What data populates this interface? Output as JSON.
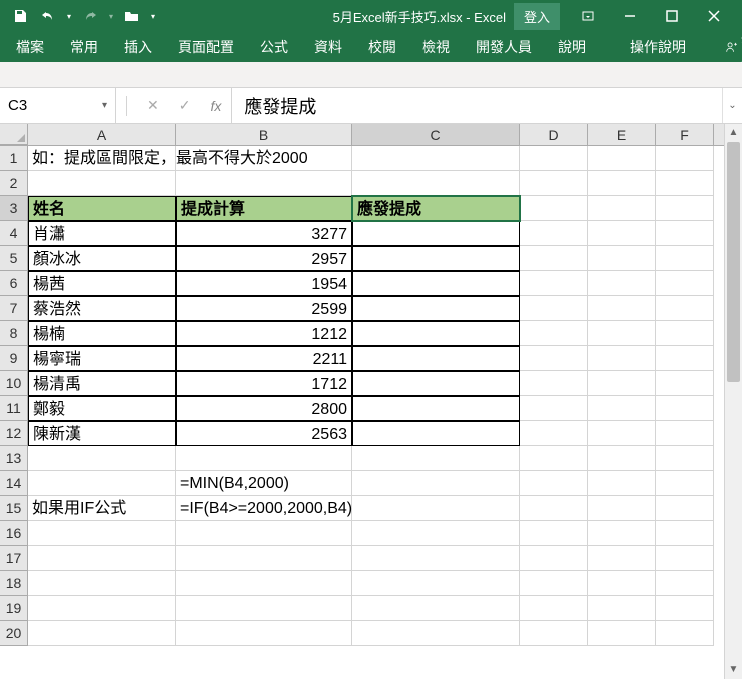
{
  "titlebar": {
    "filename": "5月Excel新手技巧.xlsx - Excel",
    "login": "登入"
  },
  "ribbon": {
    "tabs": [
      "檔案",
      "常用",
      "插入",
      "頁面配置",
      "公式",
      "資料",
      "校閱",
      "檢視",
      "開發人員",
      "說明"
    ],
    "tell_me": "操作說明",
    "share": "共用"
  },
  "formula_bar": {
    "name_box": "C3",
    "fx": "fx",
    "value": "應發提成"
  },
  "columns": [
    "A",
    "B",
    "C",
    "D",
    "E",
    "F"
  ],
  "sheet": {
    "row1": {
      "A": "如：提成區間限定，最高不得大於2000"
    },
    "headers": {
      "A": "姓名",
      "B": "提成計算",
      "C": "應發提成"
    },
    "data_rows": [
      {
        "r": 4,
        "name": "肖瀟",
        "calc": 3277
      },
      {
        "r": 5,
        "name": "顏冰冰",
        "calc": 2957
      },
      {
        "r": 6,
        "name": "楊茜",
        "calc": 1954
      },
      {
        "r": 7,
        "name": "蔡浩然",
        "calc": 2599
      },
      {
        "r": 8,
        "name": "楊楠",
        "calc": 1212
      },
      {
        "r": 9,
        "name": "楊寧瑞",
        "calc": 2211
      },
      {
        "r": 10,
        "name": "楊清禹",
        "calc": 1712
      },
      {
        "r": 11,
        "name": "鄭毅",
        "calc": 2800
      },
      {
        "r": 12,
        "name": "陳新漢",
        "calc": 2563
      }
    ],
    "row14": {
      "B": "=MIN(B4,2000)"
    },
    "row15": {
      "A": "如果用IF公式",
      "B": "=IF(B4>=2000,2000,B4)"
    }
  },
  "active_cell": "C3"
}
